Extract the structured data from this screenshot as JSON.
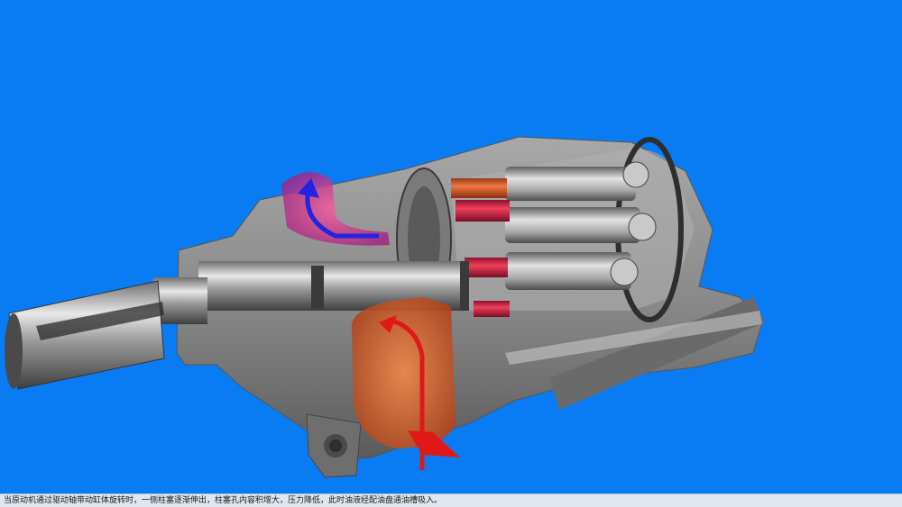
{
  "caption": {
    "text": "当原动机通过驱动轴带动缸体旋转时，一侧柱塞逐渐伸出，柱塞孔内容积增大，压力降低，此时油液经配油盘通油槽吸入。"
  },
  "colors": {
    "background": "#0a7cf3",
    "metal": "#9a9a9a",
    "oil_inlet": "#d65a2a",
    "oil_outlet": "#c02a9a",
    "flow_inlet_arrow": "#e01818",
    "flow_outlet_arrow": "#2a2ae0"
  }
}
